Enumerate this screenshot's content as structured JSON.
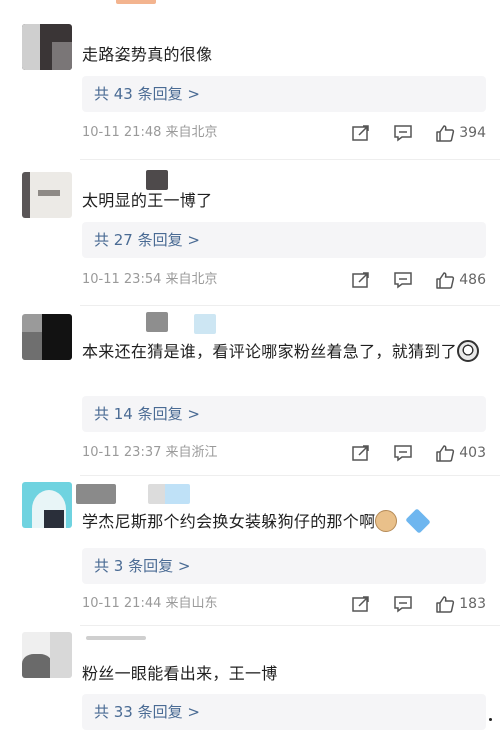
{
  "comments": [
    {
      "text": "走路姿势真的很像",
      "replies": "共 43 条回复 >",
      "time": "10-11 21:48",
      "location": "来自北京",
      "likes": "394"
    },
    {
      "text": "太明显的王一博了",
      "replies": "共 27 条回复 >",
      "time": "10-11 23:54",
      "location": "来自北京",
      "likes": "486"
    },
    {
      "text": "本来还在猜是谁，看评论哪家粉丝着急了，就猜到了",
      "replies": "共 14 条回复 >",
      "time": "10-11 23:37",
      "location": "来自浙江",
      "likes": "403"
    },
    {
      "text": "学杰尼斯那个约会换女装躲狗仔的那个啊",
      "replies": "共 3 条回复 >",
      "time": "10-11 21:44",
      "location": "来自山东",
      "likes": "183"
    },
    {
      "text": "粉丝一眼能看出来，王一博",
      "replies": "共 33 条回复 >"
    }
  ],
  "icons": {
    "share": "share-icon",
    "comment": "comment-icon",
    "like": "thumbs-up-icon"
  },
  "colors": {
    "link": "#4a6b94",
    "meta": "#9a9a9a",
    "reply_bg": "#f5f5f7"
  }
}
